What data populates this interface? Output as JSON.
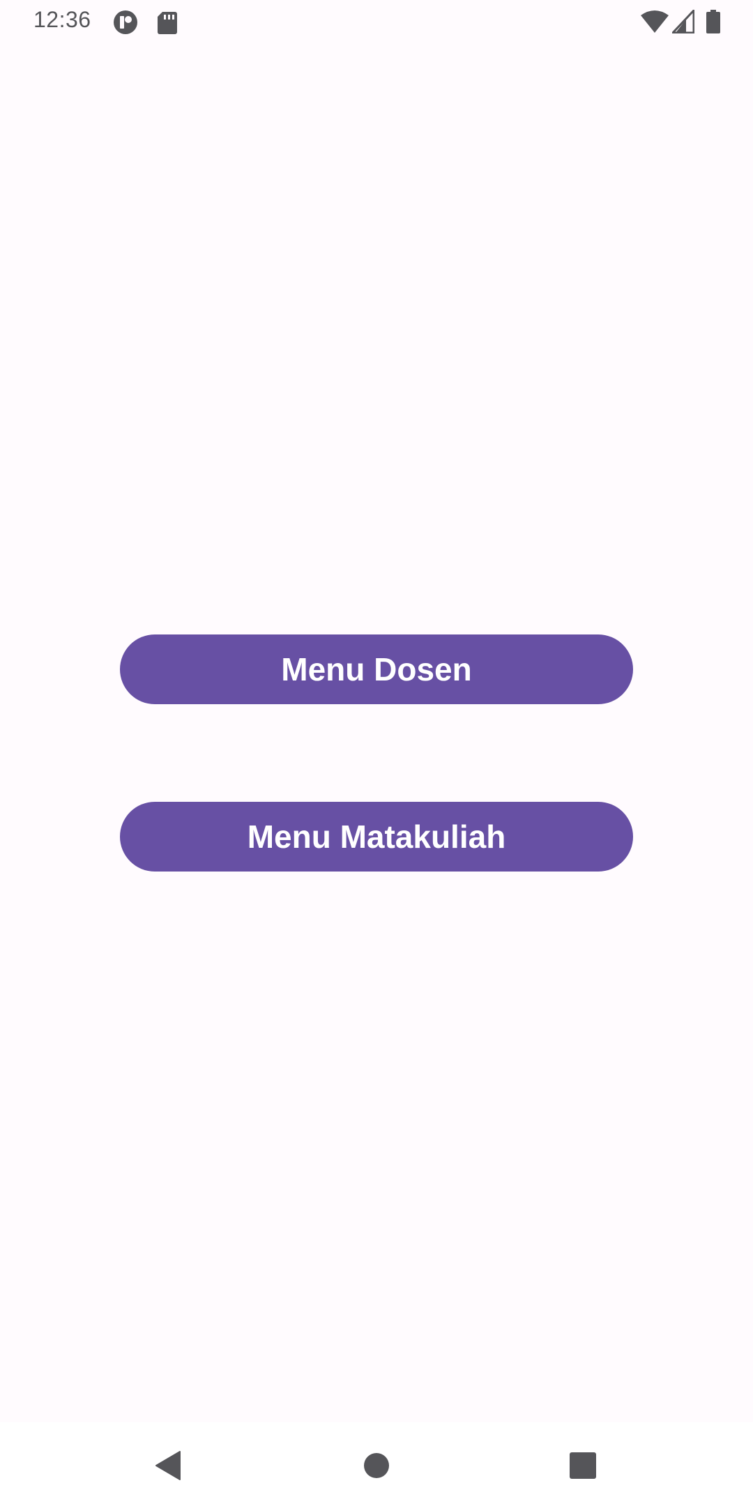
{
  "status_bar": {
    "time": "12:36",
    "left_icons": [
      "app-notification-icon",
      "sd-card-icon"
    ],
    "right_icons": [
      "wifi-icon",
      "cell-signal-icon",
      "battery-icon"
    ]
  },
  "main": {
    "buttons": [
      {
        "label": "Menu Dosen"
      },
      {
        "label": "Menu Matakuliah"
      }
    ]
  },
  "nav_bar": {
    "icons": [
      "back-icon",
      "home-icon",
      "recents-icon"
    ]
  },
  "colors": {
    "background": "#fffbfe",
    "button": "#6750a4",
    "button_text": "#ffffff",
    "status_icon": "#555559"
  }
}
